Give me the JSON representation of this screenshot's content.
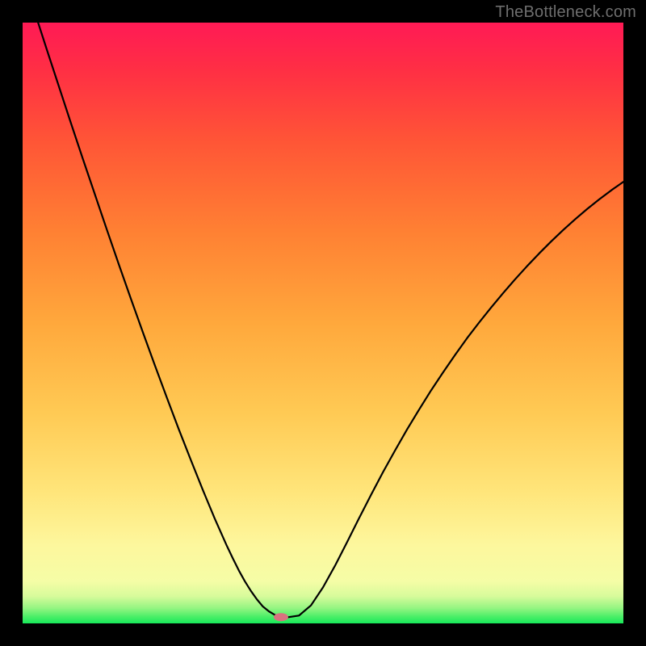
{
  "watermark": "TheBottleneck.com",
  "chart_data": {
    "type": "line",
    "title": "",
    "xlabel": "",
    "ylabel": "",
    "xlim": [
      0,
      100
    ],
    "ylim": [
      0,
      100
    ],
    "x": [
      0,
      2,
      4,
      6,
      8,
      10,
      12,
      14,
      16,
      18,
      20,
      22,
      24,
      26,
      28,
      30,
      32,
      34,
      35,
      36,
      37,
      38,
      39,
      40,
      41,
      42,
      43,
      44,
      46,
      48,
      50,
      52,
      54,
      56,
      58,
      60,
      62,
      64,
      66,
      68,
      70,
      72,
      74,
      76,
      78,
      80,
      82,
      84,
      86,
      88,
      90,
      92,
      94,
      96,
      98,
      100
    ],
    "values": [
      108,
      101.8,
      95.6,
      89.5,
      83.4,
      77.4,
      71.5,
      65.6,
      59.8,
      54.1,
      48.5,
      43.0,
      37.6,
      32.3,
      27.2,
      22.2,
      17.4,
      12.9,
      10.8,
      8.8,
      7.0,
      5.4,
      4.0,
      2.8,
      2.0,
      1.4,
      1.05,
      1.0,
      1.3,
      3.0,
      6.0,
      9.6,
      13.5,
      17.5,
      21.4,
      25.2,
      28.8,
      32.3,
      35.6,
      38.8,
      41.8,
      44.7,
      47.5,
      50.1,
      52.6,
      55.0,
      57.3,
      59.5,
      61.6,
      63.6,
      65.5,
      67.3,
      69.0,
      70.6,
      72.1,
      73.5
    ],
    "bottleneck_point": {
      "x": 43,
      "y": 1.05
    },
    "gradient_stops": [
      {
        "offset": 0.0,
        "color": "#17e859"
      },
      {
        "offset": 0.012,
        "color": "#4fef69"
      },
      {
        "offset": 0.025,
        "color": "#93f581"
      },
      {
        "offset": 0.045,
        "color": "#d7fb9b"
      },
      {
        "offset": 0.07,
        "color": "#f5fda6"
      },
      {
        "offset": 0.13,
        "color": "#fdf79d"
      },
      {
        "offset": 0.22,
        "color": "#ffe57a"
      },
      {
        "offset": 0.35,
        "color": "#ffca54"
      },
      {
        "offset": 0.5,
        "color": "#ffa83c"
      },
      {
        "offset": 0.65,
        "color": "#ff8133"
      },
      {
        "offset": 0.8,
        "color": "#ff5636"
      },
      {
        "offset": 0.92,
        "color": "#ff2f44"
      },
      {
        "offset": 1.0,
        "color": "#ff1a55"
      }
    ],
    "marker": {
      "fill": "#d9727f",
      "rx": 9,
      "ry": 5
    }
  }
}
